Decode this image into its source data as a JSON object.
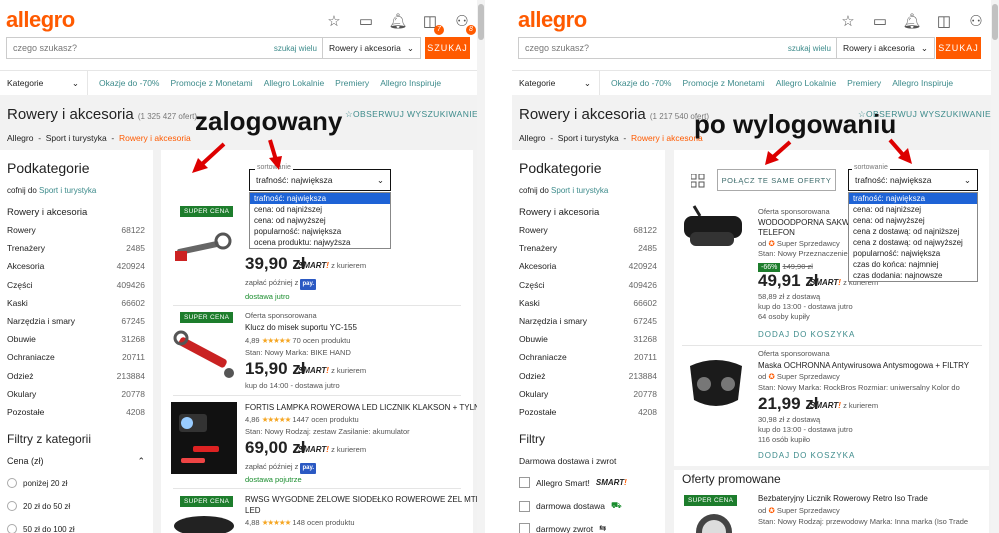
{
  "left": {
    "logo": "allegro",
    "search": {
      "placeholder": "czego szukasz?",
      "many": "szukaj wielu",
      "category": "Rowery i akcesoria",
      "button": "SZUKAJ"
    },
    "badges": {
      "cart": "7",
      "user": "8"
    },
    "nav": {
      "categories": "Kategorie",
      "items": [
        "Okazje do -70%",
        "Promocje z Monetami",
        "Allegro Lokalnie",
        "Premiery",
        "Allegro Inspiruje"
      ]
    },
    "title": "Rowery i akcesoria",
    "count": "(1 325 427 ofert)",
    "observe": "OBSERWUJ WYSZUKIWANIE",
    "crumbs": [
      "Allegro",
      "Sport i turystyka",
      "Rowery i akcesoria"
    ],
    "sidebar": {
      "heading": "Podkategorie",
      "back_prefix": "cofnij do",
      "back_link": "Sport i turystyka",
      "current": "Rowery i akcesoria",
      "cats": [
        [
          "Rowery",
          "68122"
        ],
        [
          "Trenażery",
          "2485"
        ],
        [
          "Akcesoria",
          "420924"
        ],
        [
          "Części",
          "409426"
        ],
        [
          "Kaski",
          "66602"
        ],
        [
          "Narzędzia i smary",
          "67245"
        ],
        [
          "Obuwie",
          "31268"
        ],
        [
          "Ochraniacze",
          "20711"
        ],
        [
          "Odzież",
          "213884"
        ],
        [
          "Okulary",
          "20778"
        ],
        [
          "Pozostałe",
          "4208"
        ]
      ],
      "filters_heading": "Filtry z kategorii",
      "price_label": "Cena (zł)",
      "price_options": [
        "poniżej 20 zł",
        "20 zł do 50 zł",
        "50 zł do 100 zł"
      ]
    },
    "sort": {
      "label": "sortowanie",
      "value": "trafność: największa",
      "options": [
        "trafność: największa",
        "cena: od najniższej",
        "cena: od najwyższej",
        "popularność: największa",
        "ocena produktu: najwyższa"
      ]
    },
    "annotation": "zalogowany",
    "offers": [
      {
        "badge": "SUPER CENA",
        "title": "",
        "price": "39,90 zł",
        "smart": "z kurierem",
        "pay": "zapłać później z",
        "pay_logo": "pay.",
        "delivery": "dostawa jutro"
      },
      {
        "badge": "SUPER CENA",
        "sponsored": "Oferta sponsorowana",
        "title": "Klucz do misek suportu YC-155",
        "rating": "4,89",
        "reviews": "70 ocen produktu",
        "meta": "Stan: Nowy   Marka: BIKE HAND",
        "price": "15,90 zł",
        "smart": "z kurierem",
        "delivery": "kup do 14:00 - dostawa jutro"
      },
      {
        "title": "FORTIS LAMPKA ROWEROWA LED LICZNIK KLAKSON + TYLNA",
        "rating": "4,86",
        "reviews": "1447 ocen produktu",
        "meta": "Stan: Nowy   Rodzaj: zestaw   Zasilanie: akumulator",
        "price": "69,00 zł",
        "smart": "z kurierem",
        "pay": "zapłać później z",
        "pay_logo": "pay.",
        "delivery": "dostawa pojutrze"
      },
      {
        "badge": "SUPER CENA",
        "title": "RWSG WYGODNE ŻELOWE SIODEŁKO ROWEROWE ŻEL MTB",
        "title2": "LED",
        "rating": "4,88",
        "reviews": "148 ocen produktu"
      }
    ]
  },
  "right": {
    "logo": "allegro",
    "search": {
      "placeholder": "czego szukasz?",
      "many": "szukaj wielu",
      "category": "Rowery i akcesoria",
      "button": "SZUKAJ"
    },
    "nav": {
      "categories": "Kategorie",
      "items": [
        "Okazje do -70%",
        "Promocje z Monetami",
        "Allegro Lokalnie",
        "Premiery",
        "Allegro Inspiruje"
      ]
    },
    "title": "Rowery i akcesoria",
    "count": "(1 217 540 ofert)",
    "observe": "OBSERWUJ WYSZUKIWANIE",
    "crumbs": [
      "Allegro",
      "Sport i turystyka",
      "Rowery i akcesoria"
    ],
    "sidebar": {
      "heading": "Podkategorie",
      "back_prefix": "cofnij do",
      "back_link": "Sport i turystyka",
      "current": "Rowery i akcesoria",
      "cats": [
        [
          "Rowery",
          "68122"
        ],
        [
          "Trenażery",
          "2485"
        ],
        [
          "Akcesoria",
          "420924"
        ],
        [
          "Części",
          "409426"
        ],
        [
          "Kaski",
          "66602"
        ],
        [
          "Narzędzia i smary",
          "67245"
        ],
        [
          "Obuwie",
          "31268"
        ],
        [
          "Ochraniacze",
          "20711"
        ],
        [
          "Odzież",
          "213884"
        ],
        [
          "Okulary",
          "20778"
        ],
        [
          "Pozostałe",
          "4208"
        ]
      ],
      "filters_heading": "Filtry",
      "delivery_heading": "Darmowa dostawa i zwrot",
      "checks": [
        "Allegro Smart!",
        "darmowa dostawa",
        "darmowy zwrot"
      ]
    },
    "merge": "POŁĄCZ TE SAME OFERTY",
    "sort": {
      "label": "sortowanie",
      "value": "trafność: największa",
      "options": [
        "trafność: największa",
        "cena: od najniższej",
        "cena: od najwyższej",
        "cena z dostawą: od najniższej",
        "cena z dostawą: od najwyższej",
        "popularność: największa",
        "czas do końca: najmniej",
        "czas dodania: najnowsze"
      ]
    },
    "annotation": "po wylogowaniu",
    "offers": [
      {
        "sponsored": "Oferta sponsorowana",
        "title": "WODOODPORNA SAKWA",
        "title2": "TELEFON",
        "seller_prefix": "od",
        "seller": "Super Sprzedawcy",
        "meta": "Stan: Nowy   Przeznaczenie",
        "discount": "-66%",
        "old_price": "149,90 zł",
        "price": "49,91 zł",
        "smart": "z kurierem",
        "with_delivery": "58,89 zł z dostawą",
        "delivery": "kup do 13:00 - dostawa jutro",
        "bought": "64 osoby kupiły",
        "add": "DODAJ DO KOSZYKA"
      },
      {
        "sponsored": "Oferta sponsorowana",
        "title": "Maska OCHRONNA Antywirusowa Antysmogowa + FILTRY",
        "seller_prefix": "od",
        "seller": "Super Sprzedawcy",
        "meta": "Stan: Nowy   Marka: RockBros   Rozmiar: uniwersalny   Kolor do",
        "price": "21,99 zł",
        "smart": "z kurierem",
        "with_delivery": "30,98 zł z dostawą",
        "delivery": "kup do 13:00 - dostawa jutro",
        "bought": "116 osób kupiło",
        "add": "DODAJ DO KOSZYKA"
      },
      {
        "section": "Oferty promowane",
        "badge": "SUPER CENA",
        "title": "Bezbateryjny Licznik Rowerowy Retro Iso Trade",
        "seller_prefix": "od",
        "seller": "Super Sprzedawcy",
        "meta": "Stan: Nowy   Rodzaj: przewodowy   Marka: Inna marka (Iso Trade"
      }
    ]
  }
}
